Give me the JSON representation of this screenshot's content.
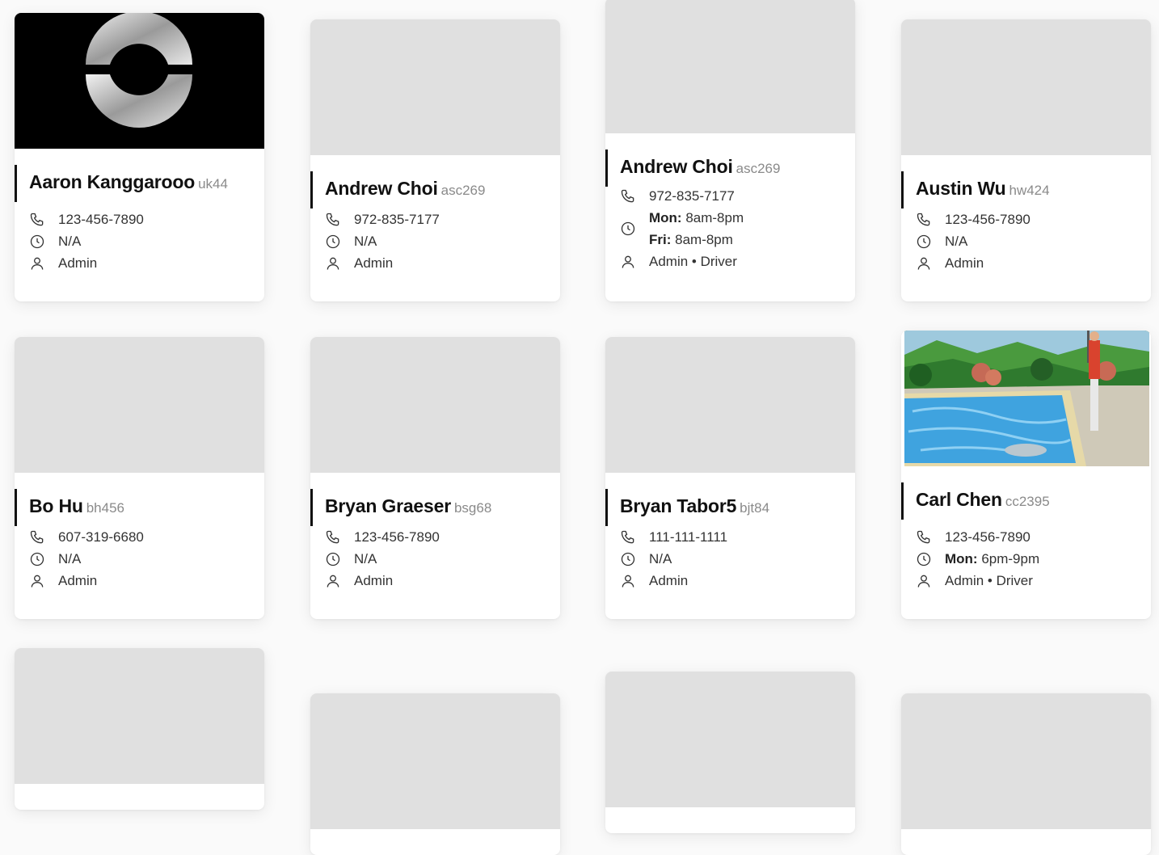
{
  "cards": [
    {
      "name": "Aaron Kanggarooo",
      "netid": "uk44",
      "phone": "123-456-7890",
      "hours": [
        {
          "day": "",
          "time": "N/A"
        }
      ],
      "roles": "Admin",
      "image": "logo-ring"
    },
    {
      "name": "Andrew Choi",
      "netid": "asc269",
      "phone": "972-835-7177",
      "hours": [
        {
          "day": "",
          "time": "N/A"
        }
      ],
      "roles": "Admin",
      "image": "placeholder"
    },
    {
      "name": "Andrew Choi",
      "netid": "asc269",
      "phone": "972-835-7177",
      "hours": [
        {
          "day": "Mon:",
          "time": "8am-8pm"
        },
        {
          "day": "Fri:",
          "time": "8am-8pm"
        }
      ],
      "roles": "Admin • Driver",
      "image": "placeholder"
    },
    {
      "name": "Austin Wu",
      "netid": "hw424",
      "phone": "123-456-7890",
      "hours": [
        {
          "day": "",
          "time": "N/A"
        }
      ],
      "roles": "Admin",
      "image": "placeholder"
    },
    {
      "name": "Bo Hu",
      "netid": "bh456",
      "phone": "607-319-6680",
      "hours": [
        {
          "day": "",
          "time": "N/A"
        }
      ],
      "roles": "Admin",
      "image": "placeholder"
    },
    {
      "name": "Bryan Graeser",
      "netid": "bsg68",
      "phone": "123-456-7890",
      "hours": [
        {
          "day": "",
          "time": "N/A"
        }
      ],
      "roles": "Admin",
      "image": "placeholder"
    },
    {
      "name": "Bryan Tabor5",
      "netid": "bjt84",
      "phone": "111-111-1111",
      "hours": [
        {
          "day": "",
          "time": "N/A"
        }
      ],
      "roles": "Admin",
      "image": "placeholder"
    },
    {
      "name": "Carl Chen",
      "netid": "cc2395",
      "phone": "123-456-7890",
      "hours": [
        {
          "day": "Mon:",
          "time": "6pm-9pm"
        }
      ],
      "roles": "Admin • Driver",
      "image": "pool-painting"
    }
  ],
  "icons": {
    "phone": "phone-icon",
    "clock": "clock-icon",
    "person": "person-icon"
  },
  "colors": {
    "placeholder": "#e0e0e0",
    "accent_bar": "#111111",
    "netid": "#8a8a8a"
  }
}
